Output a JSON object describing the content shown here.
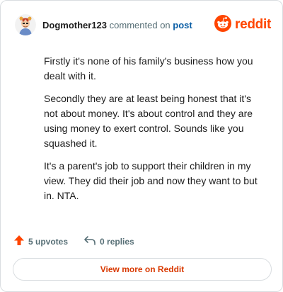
{
  "header": {
    "username": "Dogmother123",
    "commented_on": "commented on",
    "post_link": "post",
    "brand_name": "reddit",
    "brand_color": "#ff4500",
    "avatar_icon": "user-avatar-icon",
    "logo_icon": "reddit-alien-icon"
  },
  "comment": {
    "paragraphs": [
      "Firstly it's none of his family's business how you dealt with it.",
      "Secondly they are at least being honest that it's not about money. It's about control and they are using money to exert control. Sounds like you squashed it.",
      "It's a parent's job to support their children in my view. They did their job and now they want to but in. NTA."
    ]
  },
  "actions": {
    "upvotes_label": "5 upvotes",
    "replies_label": "0 replies",
    "upvote_icon": "upvote-arrow-icon",
    "reply_icon": "reply-arrow-icon",
    "upvote_color": "#ff4500"
  },
  "footer": {
    "view_more_label": "View more on Reddit",
    "link_color": "#d93900"
  }
}
